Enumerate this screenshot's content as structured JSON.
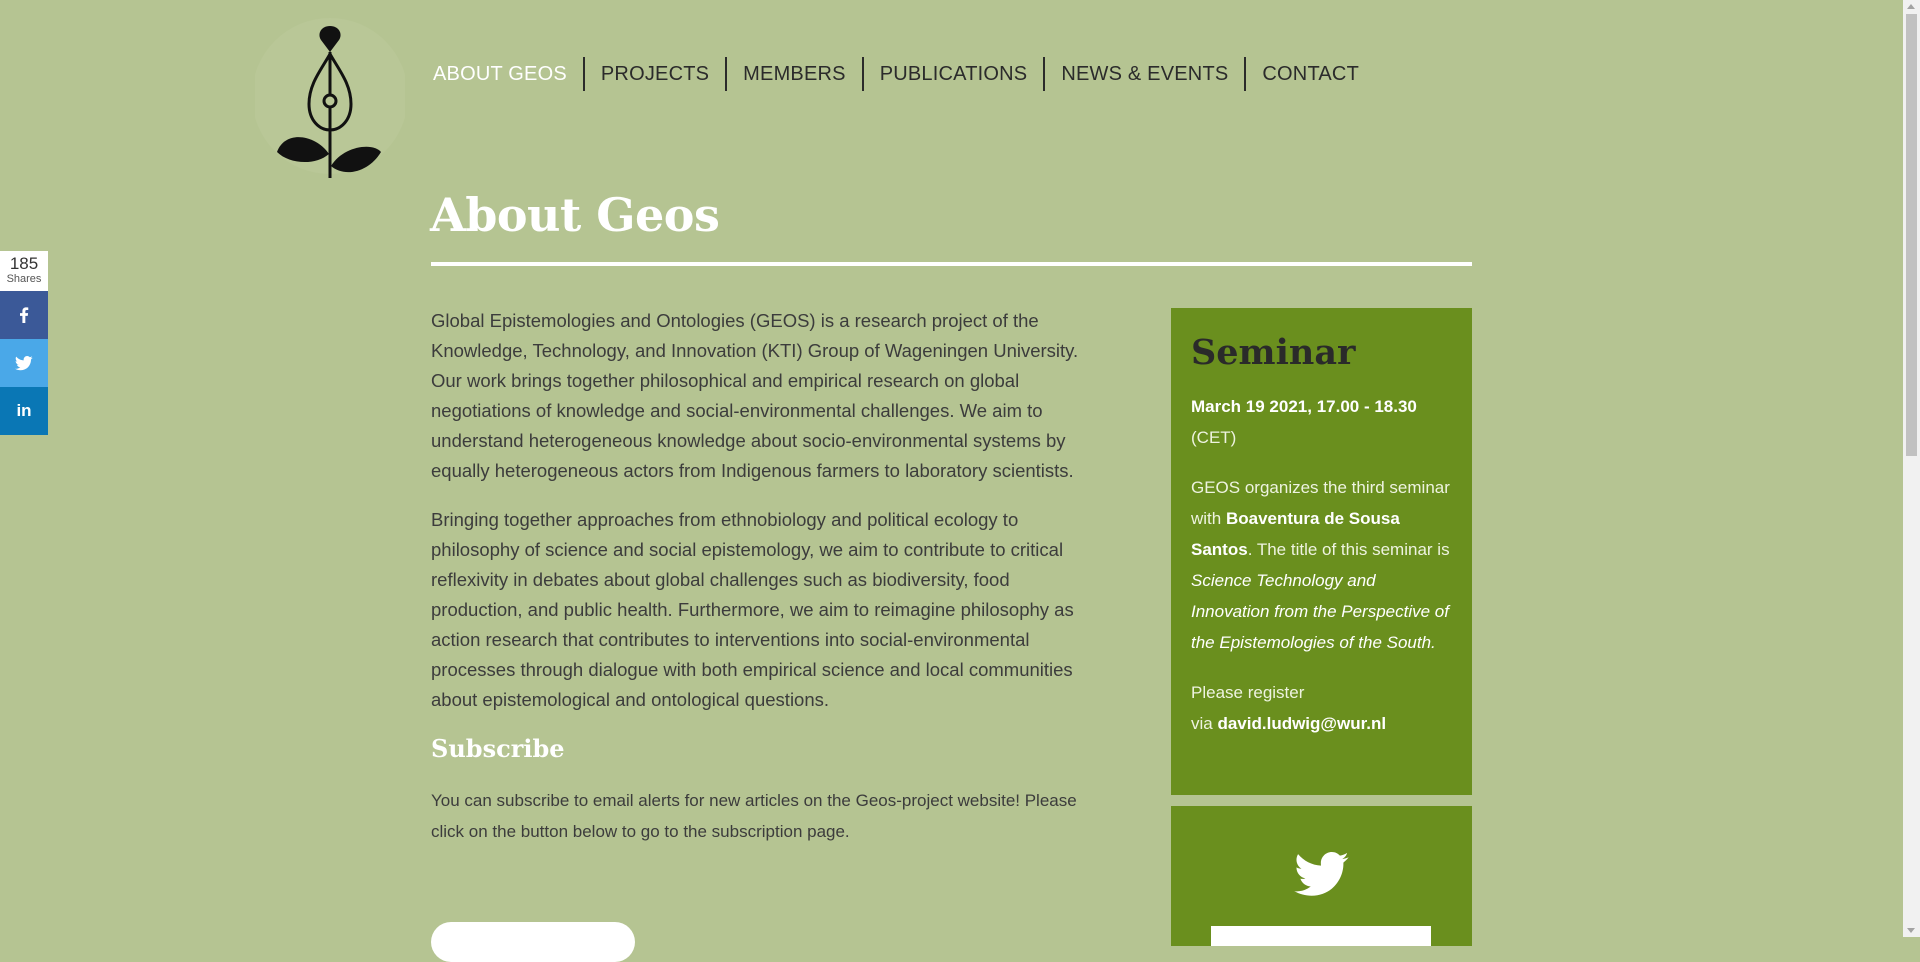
{
  "nav": {
    "items": [
      {
        "label": "ABOUT GEOS",
        "active": true
      },
      {
        "label": "PROJECTS"
      },
      {
        "label": "MEMBERS"
      },
      {
        "label": "PUBLICATIONS"
      },
      {
        "label": "NEWS & EVENTS"
      },
      {
        "label": "CONTACT"
      }
    ]
  },
  "page": {
    "title": "About Geos",
    "paragraphs": [
      "Global Epistemologies and Ontologies (GEOS) is a research project of the Knowledge, Technology, and Innovation (KTI) Group of Wageningen University. Our work brings together philosophical and empirical research on global negotiations of knowledge and social-environmental challenges. We aim to understand heterogeneous knowledge about socio-environmental systems by equally heterogeneous actors from Indigenous farmers to laboratory scientists.",
      "Bringing together approaches from ethnobiology and political ecology to philosophy of science and social epistemology, we aim to contribute to critical reflexivity in debates about global challenges such as biodiversity, food production, and public health. Furthermore, we aim to reimagine philosophy as action research that contributes to interventions into social-environmental processes through dialogue with both empirical science and local communities about epistemological and ontological questions."
    ],
    "subscribe": {
      "heading": "Subscribe",
      "text": "You can subscribe to email alerts for new articles on the Geos-project website! Please click on the button below to go to the subscription page."
    }
  },
  "seminar": {
    "title": "Seminar",
    "date": "March 19  2021, 17.00 - 18.30",
    "timezone": "(CET)",
    "intro": "GEOS organizes the third seminar with",
    "speaker": "Boaventura de Sousa Santos",
    "title_intro": "The title of this seminar is",
    "seminar_title": "Science Technology and Innovation from the Perspective of the Epistemologies of the South.",
    "register": "Please register",
    "via": "via",
    "email": "david.ludwig@wur.nl"
  },
  "share": {
    "count": "185",
    "label": "Shares",
    "buttons": [
      "facebook-icon",
      "twitter-icon",
      "linkedin-icon"
    ],
    "colors": {
      "facebook": "#3b5998",
      "twitter": "#4aa8e8",
      "linkedin": "#0a77b5"
    }
  },
  "colors": {
    "background": "#b5c492",
    "sidebar_box": "#6a8f1e",
    "active_nav": "#ffffff"
  }
}
